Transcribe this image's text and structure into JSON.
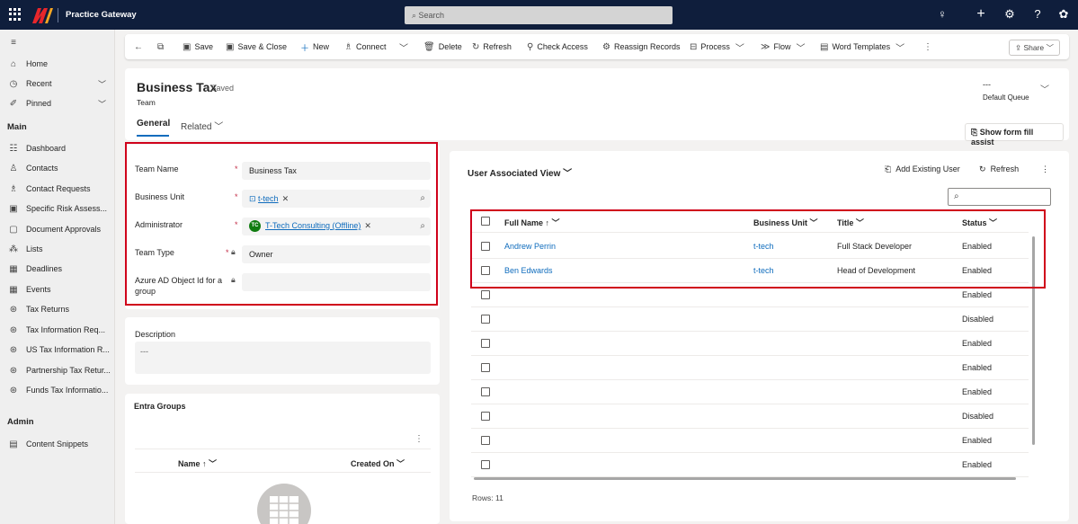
{
  "topbar": {
    "app_title": "Practice Gateway",
    "search_placeholder": "Search",
    "icons": [
      "waffle-icon",
      "lightbulb-icon",
      "plus-icon",
      "gear-icon",
      "help-icon",
      "copilot-icon"
    ]
  },
  "nav": {
    "home": "Home",
    "recent": "Recent",
    "pinned": "Pinned",
    "main_heading": "Main",
    "main_items": [
      "Dashboard",
      "Contacts",
      "Contact Requests",
      "Specific Risk Assess...",
      "Document Approvals",
      "Lists",
      "Deadlines",
      "Events",
      "Tax Returns",
      "Tax Information Req...",
      "US Tax Information R...",
      "Partnership Tax Retur...",
      "Funds Tax Informatio..."
    ],
    "admin_heading": "Admin",
    "admin_items": [
      "Content Snippets"
    ]
  },
  "commands": {
    "save": "Save",
    "save_close": "Save & Close",
    "new": "New",
    "connect": "Connect",
    "delete": "Delete",
    "refresh": "Refresh",
    "check_access": "Check Access",
    "reassign": "Reassign Records",
    "process": "Process",
    "flow": "Flow",
    "word_templates": "Word Templates",
    "share": "Share"
  },
  "record": {
    "title": "Business Tax",
    "saved": "- Saved",
    "entity": "Team",
    "tab_general": "General",
    "tab_related": "Related",
    "queue_value": "---",
    "queue_label": "Default Queue",
    "form_fill_assist": "Show form fill assist"
  },
  "fields": {
    "team_name_label": "Team Name",
    "team_name_value": "Business Tax",
    "business_unit_label": "Business Unit",
    "business_unit_value": "t-tech",
    "administrator_label": "Administrator",
    "administrator_value": "T-Tech Consulting (Offline)",
    "administrator_initials": "TC",
    "team_type_label": "Team Type",
    "team_type_value": "Owner",
    "aad_label_1": "Azure AD Object Id for a",
    "aad_label_2": "group",
    "required_mark": "*"
  },
  "description": {
    "label": "Description",
    "value": "---"
  },
  "entra": {
    "title": "Entra Groups",
    "col_name": "Name ↑",
    "col_created": "Created On"
  },
  "grid": {
    "title": "User Associated View",
    "add_existing": "Add Existing User",
    "refresh": "Refresh",
    "columns": {
      "full_name": "Full Name ↑",
      "business_unit": "Business Unit",
      "title": "Title",
      "status": "Status"
    },
    "rows": [
      {
        "name": "Andrew Perrin",
        "bu": "t-tech",
        "title": "Full Stack Developer",
        "status": "Enabled"
      },
      {
        "name": "Ben Edwards",
        "bu": "t-tech",
        "title": "Head of Development",
        "status": "Enabled"
      },
      {
        "name": "",
        "bu": "",
        "title": "",
        "status": "Enabled"
      },
      {
        "name": "",
        "bu": "",
        "title": "",
        "status": "Disabled"
      },
      {
        "name": "",
        "bu": "",
        "title": "",
        "status": "Enabled"
      },
      {
        "name": "",
        "bu": "",
        "title": "",
        "status": "Enabled"
      },
      {
        "name": "",
        "bu": "",
        "title": "",
        "status": "Enabled"
      },
      {
        "name": "",
        "bu": "",
        "title": "",
        "status": "Disabled"
      },
      {
        "name": "",
        "bu": "",
        "title": "",
        "status": "Enabled"
      },
      {
        "name": "",
        "bu": "",
        "title": "",
        "status": "Enabled"
      }
    ],
    "rows_count": "Rows: 11"
  },
  "colors": {
    "topbar": "#0f1e3c",
    "link": "#0f6cbd",
    "highlight": "#d0021b"
  }
}
